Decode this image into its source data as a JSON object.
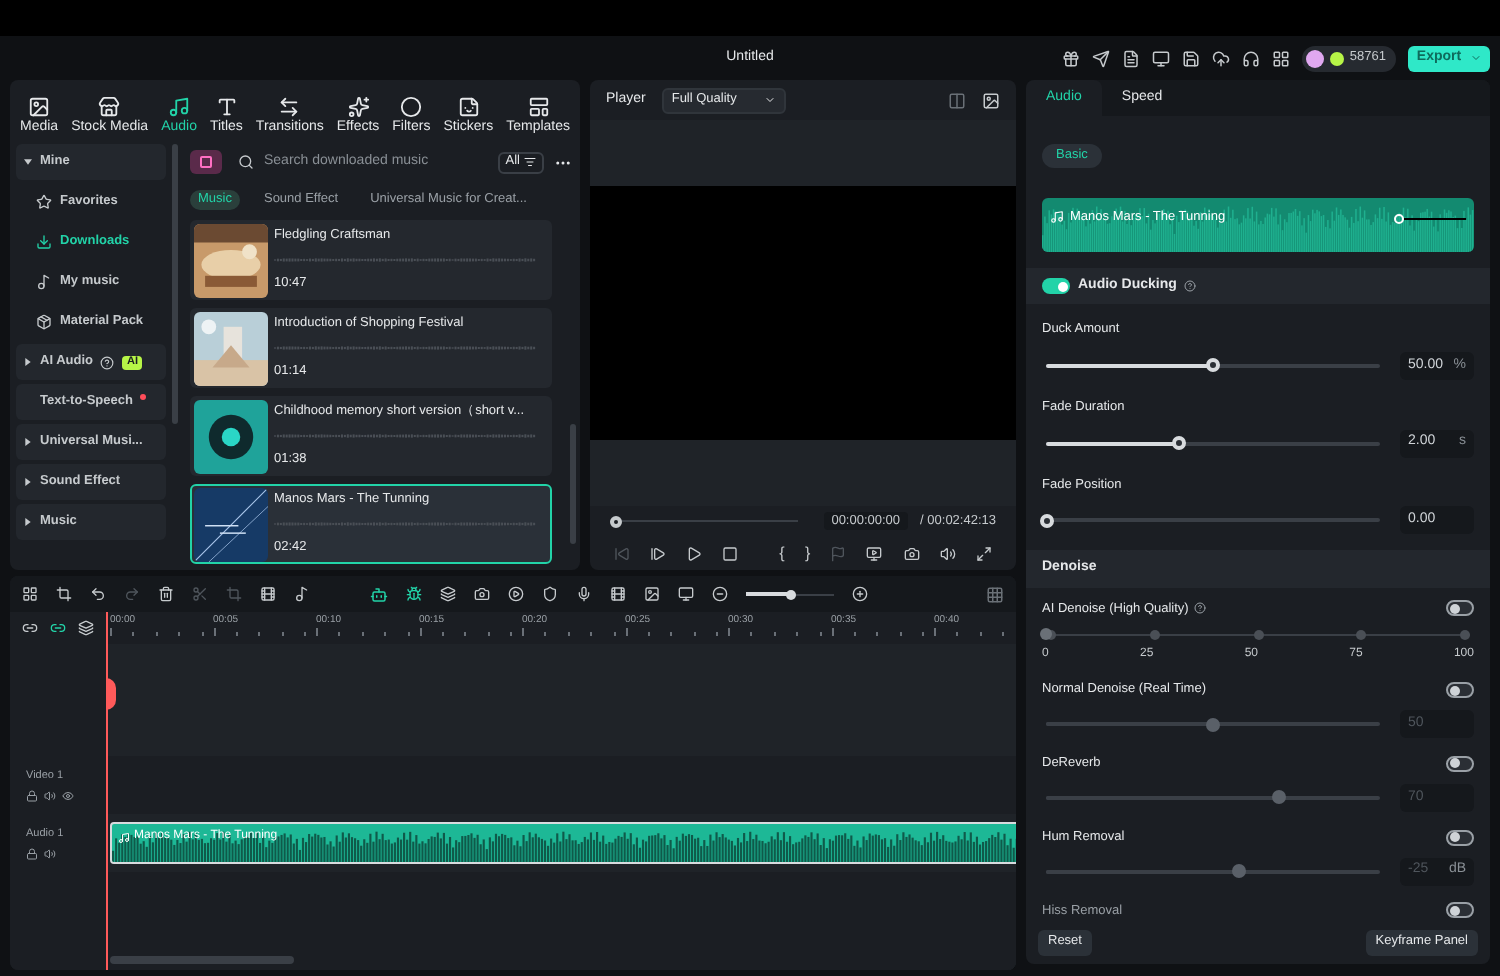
{
  "window": {
    "title": "Untitled"
  },
  "toolbar": {
    "coins": "58761",
    "export": "Export"
  },
  "media_tabs": [
    {
      "label": "Media",
      "selected": false
    },
    {
      "label": "Stock Media",
      "selected": false
    },
    {
      "label": "Audio",
      "selected": true
    },
    {
      "label": "Titles",
      "selected": false
    },
    {
      "label": "Transitions",
      "selected": false
    },
    {
      "label": "Effects",
      "selected": false
    },
    {
      "label": "Filters",
      "selected": false
    },
    {
      "label": "Stickers",
      "selected": false
    },
    {
      "label": "Templates",
      "selected": false
    }
  ],
  "sidebar": {
    "items": [
      {
        "label": "Mine",
        "kind": "group",
        "expanded": true,
        "selected": false
      },
      {
        "label": "Favorites",
        "kind": "item",
        "selected": false
      },
      {
        "label": "Downloads",
        "kind": "item",
        "selected": true
      },
      {
        "label": "My music",
        "kind": "item",
        "selected": false
      },
      {
        "label": "Material Pack",
        "kind": "item",
        "selected": false
      },
      {
        "label": "AI Audio",
        "kind": "group",
        "expanded": false,
        "selected": false,
        "help": true,
        "badge": "AI"
      },
      {
        "label": "Text-to-Speech",
        "kind": "plain",
        "selected": false,
        "new": true
      },
      {
        "label": "Universal Musi...",
        "kind": "group",
        "expanded": false,
        "selected": false
      },
      {
        "label": "Sound Effect",
        "kind": "group",
        "expanded": false,
        "selected": false
      },
      {
        "label": "Music",
        "kind": "group",
        "expanded": false,
        "selected": false
      }
    ]
  },
  "search": {
    "placeholder": "Search downloaded music",
    "filter": "All"
  },
  "sub_tabs": [
    {
      "label": "Music",
      "selected": true
    },
    {
      "label": "Sound Effect",
      "selected": false
    },
    {
      "label": "Universal Music for Creat...",
      "selected": false
    }
  ],
  "tracks": [
    {
      "title": "Fledgling Craftsman",
      "duration": "10:47",
      "kind": "wood",
      "selected": false
    },
    {
      "title": "Introduction of Shopping Festival",
      "duration": "01:14",
      "kind": "sky",
      "selected": false
    },
    {
      "title": "Childhood memory short version（short v...",
      "duration": "01:38",
      "kind": "disc",
      "selected": false
    },
    {
      "title": "Manos Mars - The Tunning",
      "duration": "02:42",
      "kind": "lines",
      "selected": true
    }
  ],
  "player": {
    "label": "Player",
    "quality": "Full Quality",
    "level": 0,
    "current": "00:00:00:00",
    "total": "/ 00:02:42:13",
    "mark_in": "{",
    "mark_out": "}"
  },
  "properties": {
    "tabs": [
      {
        "label": "Audio",
        "selected": true
      },
      {
        "label": "Speed",
        "selected": false
      }
    ],
    "sub_tab": "Basic",
    "clip": "Manos Mars - The Tunning",
    "ducking": {
      "label": "Audio Ducking",
      "on": true,
      "help": true
    },
    "sliders": [
      {
        "label": "Duck Amount",
        "level": 0.5,
        "value": "50.00",
        "unit": "%"
      },
      {
        "label": "Fade Duration",
        "level": 0.4,
        "value": "2.00",
        "unit": "s"
      },
      {
        "label": "Fade Position",
        "level": 0,
        "value": "0.00"
      }
    ],
    "denoise_title": "Denoise",
    "denoise": [
      {
        "label": "AI Denoise (High Quality)",
        "kind": "steps",
        "on": false,
        "help": true,
        "level": 0,
        "ticks": [
          "0",
          "25",
          "50",
          "75",
          "100"
        ]
      },
      {
        "label": "Normal Denoise (Real Time)",
        "kind": "slider",
        "on": false,
        "level": 0.5,
        "value": "50",
        "disabled": true
      },
      {
        "label": "DeReverb",
        "kind": "slider",
        "on": false,
        "level": 0.7,
        "value": "70",
        "disabled": true
      },
      {
        "label": "Hum Removal",
        "kind": "slider",
        "on": false,
        "level": 0.58,
        "value": "-25",
        "unit": "dB",
        "disabled": true
      },
      {
        "label": "Hiss Removal",
        "kind": "toggle",
        "on": false
      }
    ],
    "reset": "Reset",
    "keyframe": "Keyframe Panel"
  },
  "timeline": {
    "zoom": {
      "level": 0.5
    },
    "ruler": [
      "00:00",
      "00:05",
      "00:10",
      "00:15",
      "00:20",
      "00:25",
      "00:30",
      "00:35",
      "00:40"
    ],
    "tracks": [
      {
        "label": "Video 1",
        "kind": "video"
      },
      {
        "label": "Audio 1",
        "kind": "audio"
      }
    ],
    "clip": "Manos Mars - The Tunning"
  }
}
